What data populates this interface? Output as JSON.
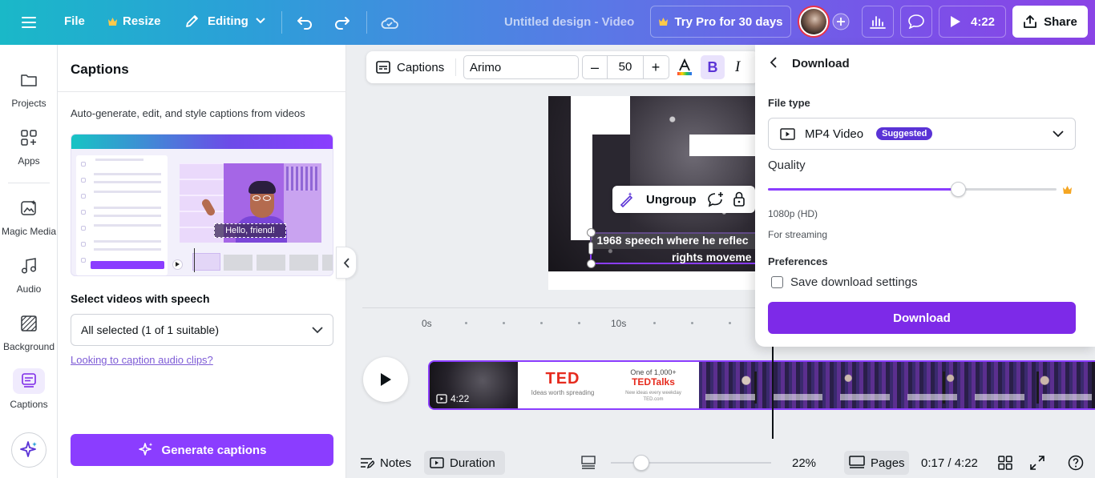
{
  "topbar": {
    "file_label": "File",
    "resize_label": "Resize",
    "editing_label": "Editing",
    "doc_title": "Untitled design - Video",
    "try_pro_label": "Try Pro for 30 days",
    "play_duration": "4:22",
    "share_label": "Share"
  },
  "rail": {
    "items": [
      {
        "label": "Projects",
        "icon": "folder-icon"
      },
      {
        "label": "Apps",
        "icon": "apps-icon"
      },
      {
        "label": "Magic Media",
        "icon": "magic-media-icon"
      },
      {
        "label": "Audio",
        "icon": "audio-icon"
      },
      {
        "label": "Background",
        "icon": "background-icon"
      },
      {
        "label": "Captions",
        "icon": "captions-icon"
      }
    ]
  },
  "captions_panel": {
    "title": "Captions",
    "description": "Auto-generate, edit, and style captions from videos",
    "illustration_caption": "Hello, friend!",
    "select_label": "Select videos with speech",
    "select_value": "All selected (1 of 1 suitable)",
    "audio_link": "Looking to caption audio clips?",
    "generate_label": "Generate captions"
  },
  "context_toolbar": {
    "captions_label": "Captions",
    "font_value": "Arimo",
    "font_size": "50",
    "bold_label": "B",
    "italic_label": "I"
  },
  "canvas": {
    "ungroup_label": "Ungroup",
    "subtitle_line1": "1968 speech where he reflec",
    "subtitle_line2": "rights moveme"
  },
  "timeline": {
    "tick_0": "0s",
    "tick_10": "10s",
    "clip_duration": "4:22",
    "ted_logo": "TED",
    "ted_tagline": "Ideas worth spreading",
    "ted_one_of": "One of 1,000+",
    "ted_talks": "TEDTalks",
    "ted_note": "New ideas every weekday",
    "ted_url": "TED.com"
  },
  "bottombar": {
    "notes_label": "Notes",
    "duration_label": "Duration",
    "zoom_value": "22%",
    "zoom_level": 0.19,
    "pages_label": "Pages",
    "time_display": "0:17 / 4:22"
  },
  "download_panel": {
    "title": "Download",
    "file_type_label": "File type",
    "file_type_value": "MP4 Video",
    "suggested_badge": "Suggested",
    "quality_label": "Quality",
    "quality_level": 0.66,
    "quality_value": "1080p (HD)",
    "quality_note": "For streaming",
    "preferences_label": "Preferences",
    "save_settings_label": "Save download settings",
    "save_settings_checked": false,
    "download_button": "Download"
  },
  "colors": {
    "accent": "#8b3dff",
    "download_button": "#7d2ae8",
    "badge": "#5a33d6"
  }
}
